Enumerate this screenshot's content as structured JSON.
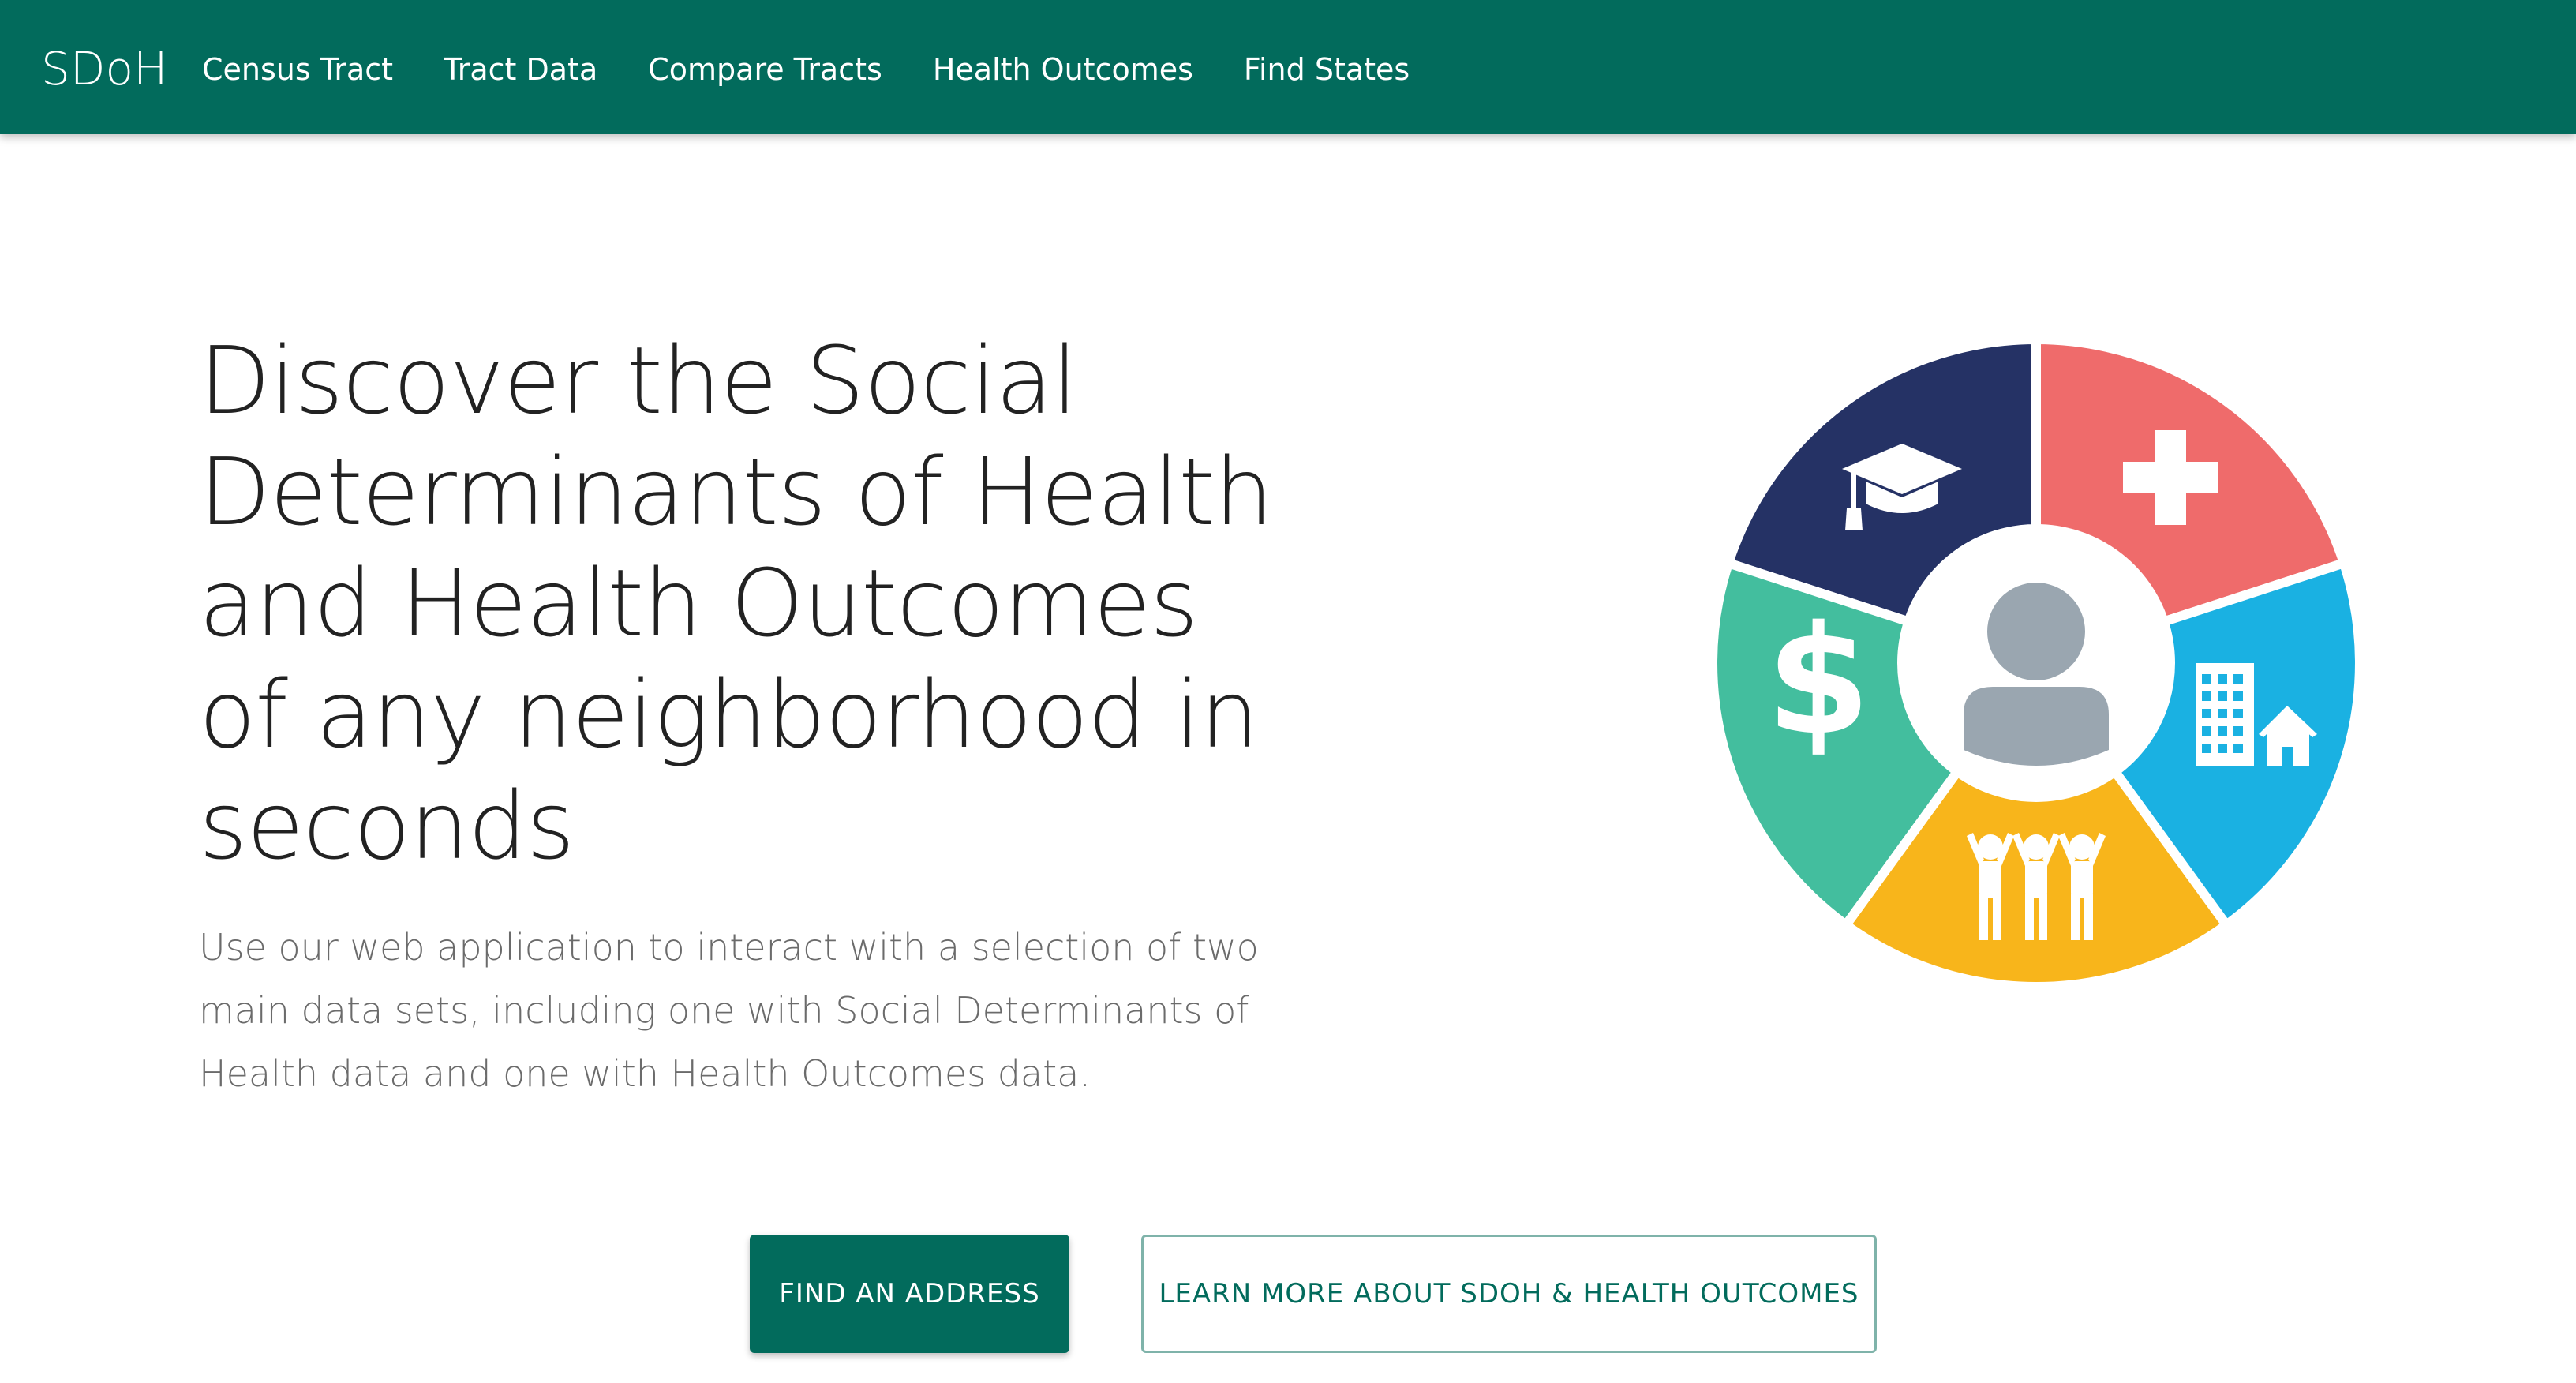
{
  "navbar": {
    "brand": "SDoH",
    "links": [
      {
        "label": "Census Tract"
      },
      {
        "label": "Tract Data"
      },
      {
        "label": "Compare Tracts"
      },
      {
        "label": "Health Outcomes"
      },
      {
        "label": "Find States"
      }
    ]
  },
  "hero": {
    "title": "Discover the Social Determinants of Health and Health Outcomes of any neighborhood in seconds",
    "description": "Use our web application to interact with a selection of two main data sets, including one with Social Determinants of Health data and one with Health Outcomes data."
  },
  "actions": {
    "primary_label": "FIND AN ADDRESS",
    "secondary_label": "LEARN MORE ABOUT SDOH & HEALTH OUTCOMES"
  },
  "wheel": {
    "segments": [
      {
        "name": "education",
        "icon": "graduation-cap-icon",
        "color": "#253265"
      },
      {
        "name": "health-care",
        "icon": "medical-cross-icon",
        "color": "#ef6b6b"
      },
      {
        "name": "neighborhood",
        "icon": "buildings-house-icon",
        "color": "#1ab1e2"
      },
      {
        "name": "community",
        "icon": "people-group-icon",
        "color": "#f8b51b"
      },
      {
        "name": "economic",
        "icon": "dollar-sign-icon",
        "color": "#43be9e"
      }
    ],
    "center_icon": "person-icon",
    "center_color": "#9aa6b0"
  },
  "colors": {
    "brand": "#026b5c",
    "title_text": "#222222",
    "body_text": "#6b6b6b"
  }
}
